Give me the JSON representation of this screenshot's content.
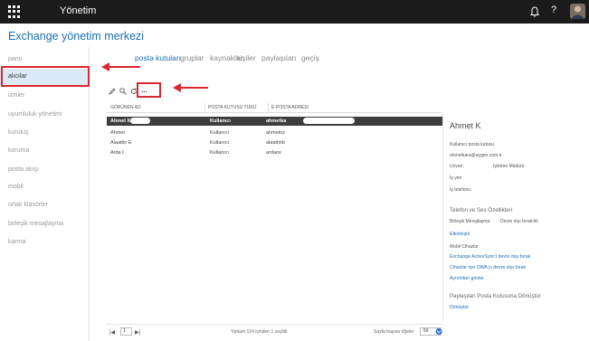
{
  "topbar": {
    "title": "Yönetim",
    "help_label": "?"
  },
  "page_title": "Exchange yönetim merkezi",
  "sidebar": {
    "items": [
      {
        "label": "pano"
      },
      {
        "label": "alıcılar"
      },
      {
        "label": "izinler"
      },
      {
        "label": "uyumluluk yönetimi"
      },
      {
        "label": "kuruluş"
      },
      {
        "label": "koruma"
      },
      {
        "label": "posta akışı"
      },
      {
        "label": "mobil"
      },
      {
        "label": "ortak klasörler"
      },
      {
        "label": "birleşik mesajlaşma"
      },
      {
        "label": "karma"
      }
    ]
  },
  "tabs": [
    {
      "label": "posta kutuları"
    },
    {
      "label": "gruplar"
    },
    {
      "label": "kaynaklar"
    },
    {
      "label": "kişiler"
    },
    {
      "label": "paylaşılan"
    },
    {
      "label": "geçiş"
    }
  ],
  "toolbar": {
    "more_label": "..."
  },
  "table": {
    "columns": [
      "GÖRÜNEN AD",
      "POSTA KUTUSU TÜRÜ",
      "E-POSTA ADRESİ"
    ],
    "rows": [
      [
        "Ahmet K",
        "Kullanıcı",
        "ahmetka"
      ],
      [
        "Ahmet",
        "Kullanıcı",
        "ahmetoz"
      ],
      [
        "Alaattin E",
        "Kullanıcı",
        "alaattinb"
      ],
      [
        "Arda I",
        "Kullanıcı",
        "ardaox"
      ]
    ]
  },
  "details": {
    "name": "Ahmet K",
    "type": "Kullanıcı posta kutusu",
    "email": "ahmetkara@aygen.com.tr",
    "title_label": "Unvan:",
    "title_value": "İşletme Müdürü",
    "workplace_label": "İş yeri",
    "phone_label": "İş telefonu:",
    "voice_heading": "Telefon ve Ses Özellikleri",
    "um_label": "Birleşik Mesajlaşma:",
    "um_value": "Devre dışı bırakıldı",
    "enable_link": "Etkinleştir",
    "mobile_label": "Mobil Cihazlar",
    "activesync_link": "Exchange ActiveSync'i devre dışı bırak",
    "owa_link": "Cihazlar için OWA'yı devre dışı bırak",
    "details_link": "Ayrıntıları göster",
    "shared_heading": "Paylaşılan Posta Kutusuna Dönüştür",
    "convert_link": "Dönüştür"
  },
  "status": {
    "page_value": "1",
    "total_text": "Toplam 124 içinden 1 seçildi",
    "per_page_label": "Sayfa başına öğeler",
    "per_page_value": "50"
  },
  "colors": {
    "accent": "#1a6fb3",
    "annotation": "#d9282e",
    "topbar": "#1b1b1b"
  }
}
